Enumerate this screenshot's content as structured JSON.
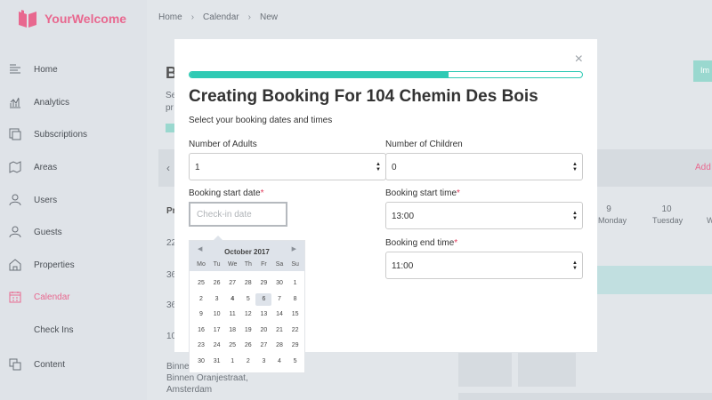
{
  "app": {
    "name": "YourWelcome",
    "brand_color": "#e8688f",
    "accent_color": "#2fcab4"
  },
  "breadcrumb": [
    "Home",
    "Calendar",
    "New"
  ],
  "sidebar": {
    "items": [
      {
        "label": "Home",
        "icon": "home-icon"
      },
      {
        "label": "Analytics",
        "icon": "analytics-icon"
      },
      {
        "label": "Subscriptions",
        "icon": "subscriptions-icon"
      },
      {
        "label": "Areas",
        "icon": "areas-icon"
      },
      {
        "label": "Users",
        "icon": "users-icon"
      },
      {
        "label": "Guests",
        "icon": "guests-icon"
      },
      {
        "label": "Properties",
        "icon": "properties-icon"
      },
      {
        "label": "Calendar",
        "icon": "calendar-icon",
        "active": true
      },
      {
        "label": "Check Ins",
        "icon": ""
      },
      {
        "label": "Content",
        "icon": "content-icon"
      }
    ]
  },
  "background": {
    "title_fragment": "B",
    "text_fragment_1": "Se",
    "text_fragment_2": "pr",
    "pr_fragment": "Pr",
    "teal_button_fragment": "Im",
    "add_link_fragment": "Add",
    "row_numbers": [
      "22",
      "36",
      "36",
      "10"
    ],
    "days": [
      {
        "num": "9",
        "name": "Monday"
      },
      {
        "num": "10",
        "name": "Tuesday"
      },
      {
        "num": "",
        "name": "W"
      }
    ],
    "address_lines": [
      "Binnen",
      "Binnen Oranjestraat,",
      "Amsterdam"
    ]
  },
  "modal": {
    "close_symbol": "×",
    "progress": 0.66,
    "title": "Creating Booking For 104 Chemin Des Bois",
    "subtitle": "Select your booking dates and times",
    "adults": {
      "label": "Number of Adults",
      "value": "1"
    },
    "children": {
      "label": "Number of Children",
      "value": "0"
    },
    "start_date": {
      "label": "Booking start date",
      "required": "*",
      "placeholder": "Check-in date"
    },
    "start_time": {
      "label": "Booking start time",
      "required": "*",
      "value": "13:00"
    },
    "end_time": {
      "label": "Booking end time",
      "required": "*",
      "value": "11:00"
    }
  },
  "datepicker": {
    "month": "October 2017",
    "prev_symbol": "◀",
    "next_symbol": "▶",
    "weekdays": [
      "Mo",
      "Tu",
      "We",
      "Th",
      "Fr",
      "Sa",
      "Su"
    ],
    "weeks": [
      [
        "25",
        "26",
        "27",
        "28",
        "29",
        "30",
        "1"
      ],
      [
        "2",
        "3",
        "4",
        "5",
        "6",
        "7",
        "8"
      ],
      [
        "9",
        "10",
        "11",
        "12",
        "13",
        "14",
        "15"
      ],
      [
        "16",
        "17",
        "18",
        "19",
        "20",
        "21",
        "22"
      ],
      [
        "23",
        "24",
        "25",
        "26",
        "27",
        "28",
        "29"
      ],
      [
        "30",
        "31",
        "1",
        "2",
        "3",
        "4",
        "5"
      ]
    ],
    "today": "4",
    "selected": "6"
  }
}
